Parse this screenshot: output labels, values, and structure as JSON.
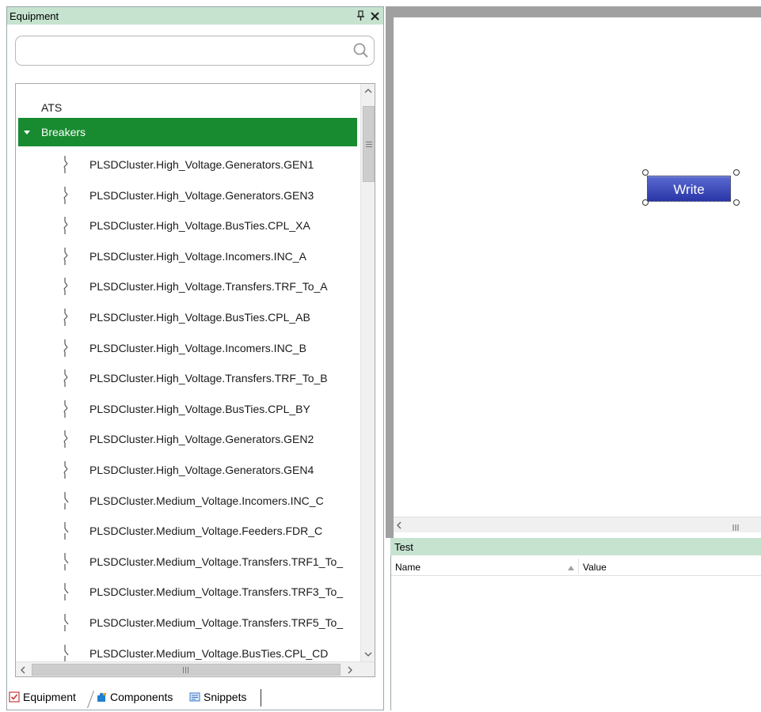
{
  "equipment_panel": {
    "title": "Equipment",
    "pin_glyph": "4",
    "close_glyph": "✕",
    "search": {
      "value": "",
      "placeholder": ""
    },
    "tree": {
      "categories": [
        {
          "label": "ATS",
          "expanded": false
        },
        {
          "label": "Breakers",
          "expanded": true,
          "selected": true,
          "highlight_color": "#188b30"
        }
      ],
      "breaker_items": [
        {
          "label": "PLSDCluster.High_Voltage.Generators.GEN1",
          "icon": "breaker-closed-icon"
        },
        {
          "label": "PLSDCluster.High_Voltage.Generators.GEN3",
          "icon": "breaker-closed-icon"
        },
        {
          "label": "PLSDCluster.High_Voltage.BusTies.CPL_XA",
          "icon": "breaker-closed-icon"
        },
        {
          "label": "PLSDCluster.High_Voltage.Incomers.INC_A",
          "icon": "breaker-closed-icon"
        },
        {
          "label": "PLSDCluster.High_Voltage.Transfers.TRF_To_A",
          "icon": "breaker-closed-icon"
        },
        {
          "label": "PLSDCluster.High_Voltage.BusTies.CPL_AB",
          "icon": "breaker-closed-icon"
        },
        {
          "label": "PLSDCluster.High_Voltage.Incomers.INC_B",
          "icon": "breaker-closed-icon"
        },
        {
          "label": "PLSDCluster.High_Voltage.Transfers.TRF_To_B",
          "icon": "breaker-closed-icon"
        },
        {
          "label": "PLSDCluster.High_Voltage.BusTies.CPL_BY",
          "icon": "breaker-closed-icon"
        },
        {
          "label": "PLSDCluster.High_Voltage.Generators.GEN2",
          "icon": "breaker-closed-icon"
        },
        {
          "label": "PLSDCluster.High_Voltage.Generators.GEN4",
          "icon": "breaker-closed-icon"
        },
        {
          "label": "PLSDCluster.Medium_Voltage.Incomers.INC_C",
          "icon": "breaker-open-icon"
        },
        {
          "label": "PLSDCluster.Medium_Voltage.Feeders.FDR_C",
          "icon": "breaker-open-icon"
        },
        {
          "label": "PLSDCluster.Medium_Voltage.Transfers.TRF1_To_",
          "icon": "breaker-open-icon"
        },
        {
          "label": "PLSDCluster.Medium_Voltage.Transfers.TRF3_To_",
          "icon": "breaker-open-icon"
        },
        {
          "label": "PLSDCluster.Medium_Voltage.Transfers.TRF5_To_",
          "icon": "breaker-open-icon"
        },
        {
          "label": "PLSDCluster.Medium_Voltage.BusTies.CPL_CD",
          "icon": "breaker-open-icon"
        }
      ]
    },
    "tabs": [
      {
        "label": "Equipment",
        "icon": "checkbox-icon",
        "active": true
      },
      {
        "label": "Components",
        "icon": "puzzle-icon",
        "active": false
      },
      {
        "label": "Snippets",
        "icon": "snippet-icon",
        "active": false
      }
    ]
  },
  "canvas": {
    "write_button_label": "Write",
    "write_button_color": "#3a48b8"
  },
  "test_panel": {
    "title": "Test",
    "columns": [
      "Name",
      "Value"
    ]
  },
  "colors": {
    "title_bar": "#c6e3cf",
    "selection": "#188b30",
    "button": "#3a48b8"
  }
}
